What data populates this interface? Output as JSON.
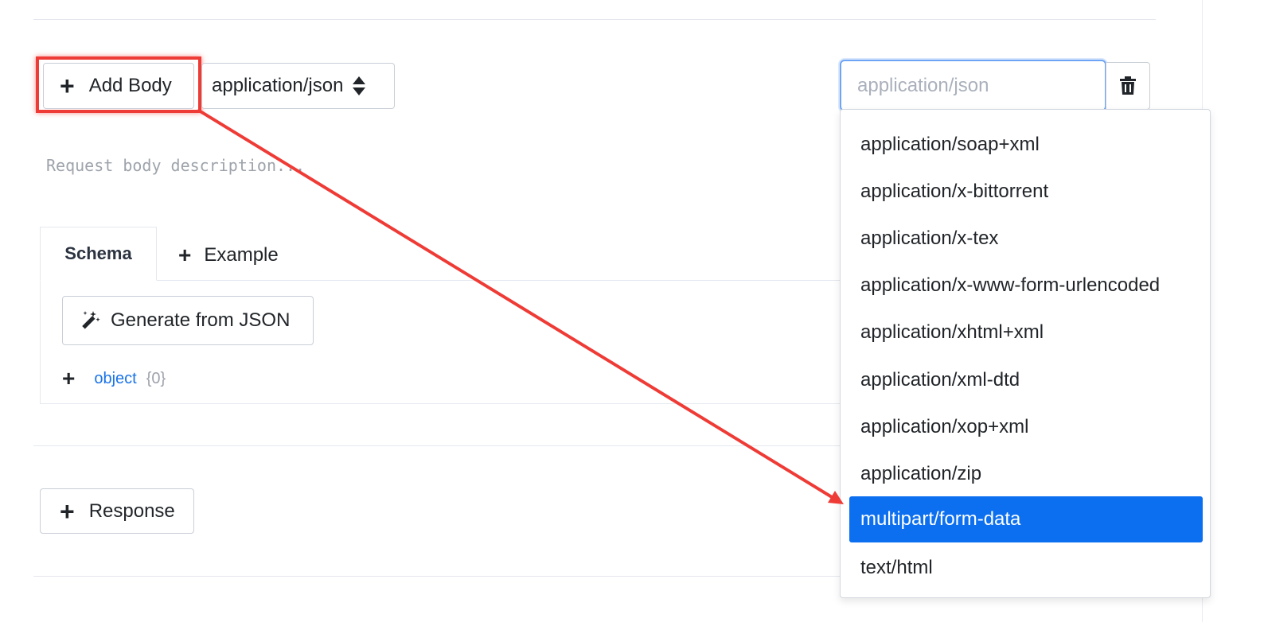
{
  "request": {
    "add_body_label": "Add Body",
    "content_type_value": "application/json",
    "description_placeholder": "Request body description..."
  },
  "schema_panel": {
    "tab_schema_label": "Schema",
    "tab_example_label": "Example",
    "generate_button_label": "Generate from JSON",
    "root_type": "object",
    "root_count": "{0}"
  },
  "response": {
    "add_response_label": "Response"
  },
  "content_type_search": {
    "placeholder": "application/json"
  },
  "dropdown": {
    "items": [
      {
        "label": "application/soap+xml",
        "selected": false
      },
      {
        "label": "application/x-bittorrent",
        "selected": false
      },
      {
        "label": "application/x-tex",
        "selected": false
      },
      {
        "label": "application/x-www-form-urlencoded",
        "selected": false
      },
      {
        "label": "application/xhtml+xml",
        "selected": false
      },
      {
        "label": "application/xml-dtd",
        "selected": false
      },
      {
        "label": "application/xop+xml",
        "selected": false
      },
      {
        "label": "application/zip",
        "selected": false
      },
      {
        "label": "multipart/form-data",
        "selected": true
      },
      {
        "label": "text/html",
        "selected": false
      }
    ]
  },
  "colors": {
    "accent": "#0b6ff0",
    "annotation": "#ef3b36",
    "link": "#1a73e8"
  },
  "icons": [
    "plus-icon",
    "sort-icon",
    "magic-wand-icon",
    "trash-icon"
  ]
}
